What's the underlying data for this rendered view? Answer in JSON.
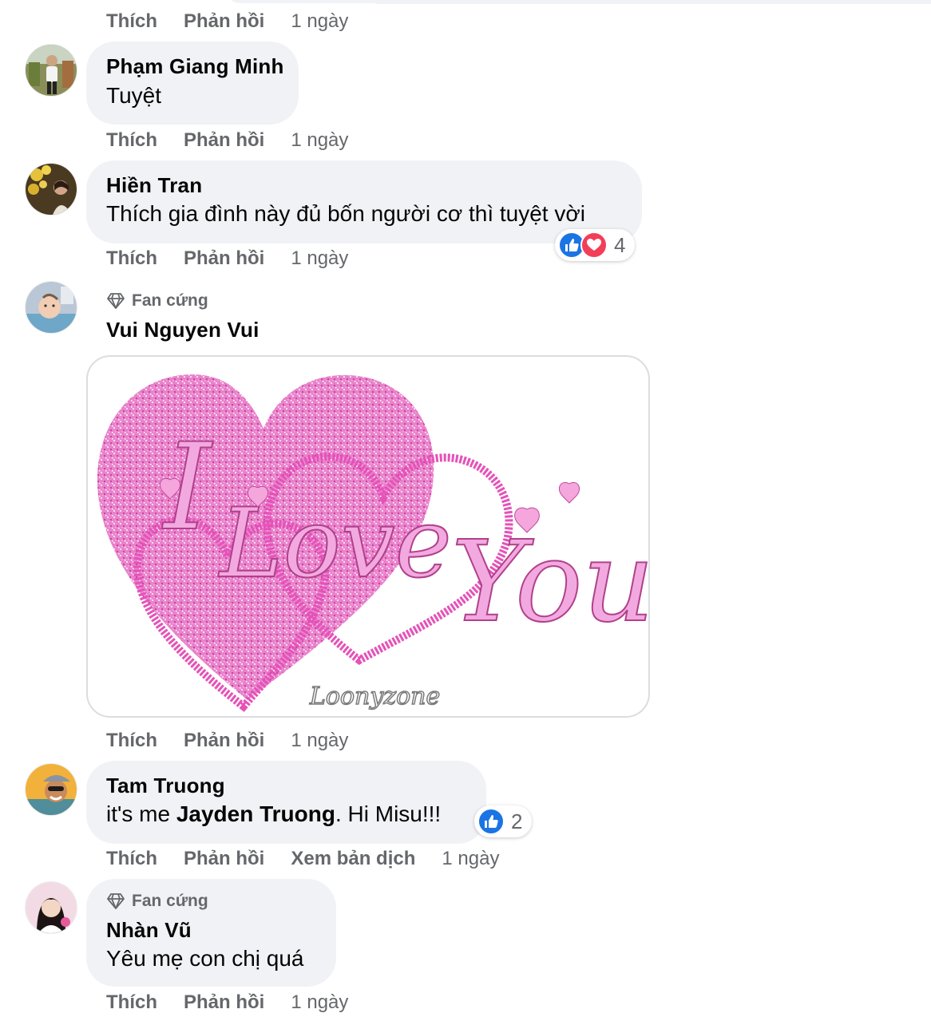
{
  "labels": {
    "like": "Thích",
    "reply": "Phản hồi",
    "translate": "Xem bản dịch",
    "badge_fan": "Fan cứng"
  },
  "top_actions": {
    "time": "1 ngày"
  },
  "comments": [
    {
      "author": "Phạm Giang Minh",
      "text": "Tuyệt",
      "time": "1 ngày"
    },
    {
      "author": "Hiền Tran",
      "text": "Thích gia đình này đủ bốn người cơ thì tuyệt vời",
      "time": "1 ngày",
      "reactions": {
        "types": [
          "like-icon",
          "love-icon"
        ],
        "count": "4"
      }
    },
    {
      "author": "Vui Nguyen Vui",
      "badge": "Fan cứng",
      "time": "1 ngày",
      "gif": {
        "caption_art": "I Love You",
        "watermark": "Loonyzone"
      }
    },
    {
      "author": "Tam Truong",
      "text_prefix": "it's me ",
      "mention": "Jayden Truong",
      "text_suffix": ". Hi Misu!!!",
      "time": "1 ngày",
      "reactions": {
        "types": [
          "like-icon"
        ],
        "count": "2"
      }
    },
    {
      "author": "Nhàn Vũ",
      "badge": "Fan cứng",
      "text": "Yêu mẹ con chị quá",
      "time": "1 ngày"
    }
  ],
  "colors": {
    "bubble": "#f0f2f5",
    "secondary_text": "#65676b",
    "like_blue": "#1b74e4",
    "love_red": "#f33e58",
    "glitter_pink": "#e552b8"
  }
}
